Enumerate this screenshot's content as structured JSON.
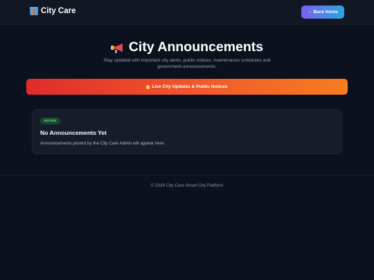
{
  "header": {
    "brand": "City Care",
    "brand_icon": "cityscape-icon",
    "home_button": "← Back Home"
  },
  "main": {
    "title": "City Announcements",
    "title_icon": "megaphone-icon",
    "subtitle": "Stay updated with important city alerts, public notices, maintenance schedules and government announcements.",
    "banner": "Live City Updates & Public Notices",
    "banner_icon": "fire-icon"
  },
  "card": {
    "badge": "NOTICE",
    "title": "No Announcements Yet",
    "text": "Announcements posted by the City Care Admin will appear here."
  },
  "footer": {
    "text": "© 2026 City Care Smart City Platform"
  },
  "colors": {
    "background": "#0b111d",
    "banner_start": "#e02b2b",
    "banner_end": "#f77d1e",
    "button_start": "#7b5ff0",
    "button_end": "#2aa7e0",
    "badge_bg": "#174a2c",
    "badge_text": "#6ee39a"
  }
}
